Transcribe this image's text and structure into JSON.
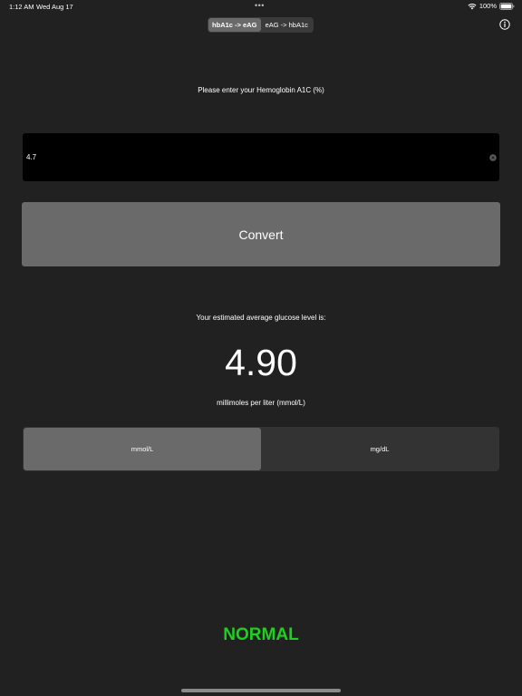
{
  "status_bar": {
    "time": "1:12 AM",
    "date": "Wed Aug 17",
    "dots": "•••",
    "battery": "100%"
  },
  "mode_segment": {
    "options": [
      "hbA1c -> eAG",
      "eAG -> hbA1c"
    ],
    "selected": "hbA1c -> eAG"
  },
  "icons": {
    "info": "info-icon",
    "clear": "clear-icon",
    "wifi": "wifi-icon",
    "battery": "battery-icon"
  },
  "input": {
    "prompt": "Please enter your Hemoglobin A1C (%)",
    "value": "4.7"
  },
  "convert_label": "Convert",
  "result": {
    "label": "Your estimated average glucose level is:",
    "value": "4.90",
    "unit_text": "millimoles per liter (mmol/L)"
  },
  "unit_segment": {
    "options": [
      "mmol/L",
      "mg/dL"
    ],
    "selected": "mmol/L"
  },
  "status": {
    "text": "NORMAL",
    "color": "#1dd11d"
  },
  "colors": {
    "background": "#212121",
    "button": "#6a6a6a",
    "input_background": "#000000"
  }
}
